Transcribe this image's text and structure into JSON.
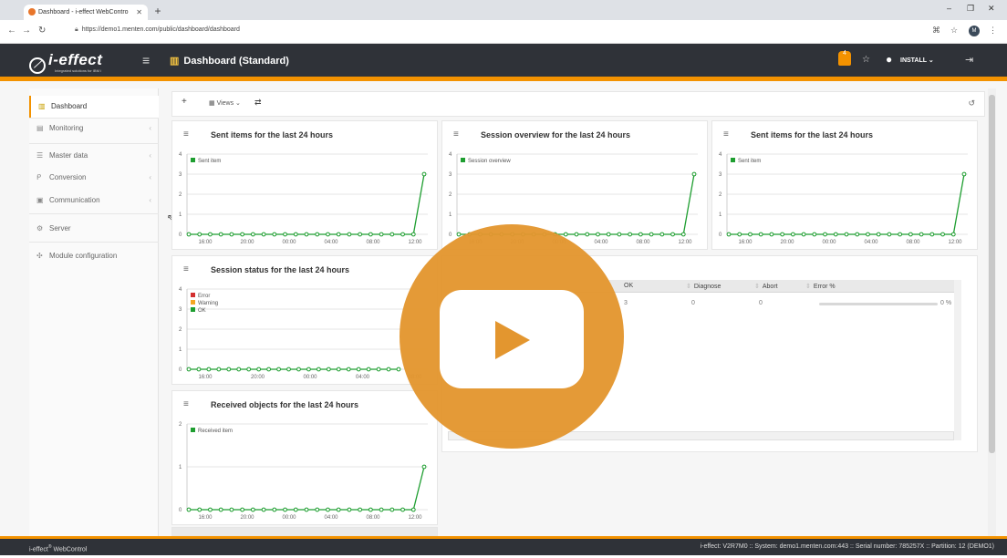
{
  "browser": {
    "tab_title": "Dashboard - i-effect WebContro",
    "url": "https://demo1.menten.com/public/dashboard/dashboard",
    "profile_initial": "M"
  },
  "header": {
    "logo": "i-effect",
    "logo_tagline": "Integrated solutions for IBM i",
    "title": "Dashboard (Standard)",
    "notification_count": "4",
    "user": "INSTALL"
  },
  "sidebar": {
    "items": [
      {
        "label": "Dashboard",
        "icon": "bar-chart-icon",
        "active": true
      },
      {
        "label": "Monitoring",
        "icon": "monitor-icon"
      },
      {
        "label": "Master data",
        "icon": "table-icon"
      },
      {
        "label": "Conversion",
        "icon": "conversion-icon"
      },
      {
        "label": "Communication",
        "icon": "communication-icon"
      },
      {
        "label": "Server",
        "icon": "cogs-icon"
      },
      {
        "label": "Module configuration",
        "icon": "modules-icon"
      }
    ]
  },
  "toolbar": {
    "views_label": "Views"
  },
  "widgets": {
    "sent_items_1": {
      "title": "Sent items for the last 24 hours"
    },
    "session_overview": {
      "title": "Session overview for the last 24 hours"
    },
    "sent_items_2": {
      "title": "Sent items for the last 24 hours"
    },
    "session_status": {
      "title": "Session status for the last 24 hours"
    },
    "received_objects": {
      "title": "Received objects for the last 24 hours"
    }
  },
  "table": {
    "columns": [
      "OK",
      "Diagnose",
      "Abort",
      "Error %"
    ],
    "row": {
      "ok": "3",
      "diagnose": "0",
      "abort": "0",
      "error_pct": "0 %"
    }
  },
  "footer": {
    "brand": "i-effect",
    "brand_suffix": "WebControl",
    "status": "i-effect: V2R7M0 :: System: demo1.menten.com:443 :: Serial number: 785257X :: Partition: 12 (DEMO1)"
  },
  "colors": {
    "accent": "#f39200",
    "header_bg": "#2f3238",
    "series_green": "#1e9e30",
    "series_red": "#d32f2f",
    "series_orange": "#f5a623",
    "play_overlay": "#e3962f"
  },
  "chart_data": [
    {
      "id": "sent_items_1",
      "type": "line",
      "title": "Sent items for the last 24 hours",
      "x": [
        "16:00",
        "20:00",
        "00:00",
        "04:00",
        "08:00",
        "12:00"
      ],
      "ylim": [
        0,
        4
      ],
      "yticks": [
        0,
        1,
        2,
        3,
        4
      ],
      "series": [
        {
          "name": "Sent item",
          "values": [
            0,
            0,
            0,
            0,
            0,
            0,
            0,
            0,
            0,
            0,
            0,
            0,
            0,
            0,
            0,
            0,
            0,
            0,
            0,
            0,
            0,
            0,
            3
          ]
        }
      ]
    },
    {
      "id": "session_overview",
      "type": "line",
      "title": "Session overview for the last 24 hours",
      "x": [
        "16:00",
        "20:00",
        "00:00",
        "04:00",
        "08:00",
        "12:00"
      ],
      "ylim": [
        0,
        4
      ],
      "yticks": [
        0,
        1,
        2,
        3,
        4
      ],
      "series": [
        {
          "name": "Session overview",
          "values": [
            0,
            0,
            0,
            0,
            0,
            0,
            0,
            0,
            0,
            0,
            0,
            0,
            0,
            0,
            0,
            0,
            0,
            0,
            0,
            0,
            0,
            0,
            3
          ]
        }
      ]
    },
    {
      "id": "sent_items_2",
      "type": "line",
      "title": "Sent items for the last 24 hours",
      "x": [
        "16:00",
        "20:00",
        "00:00",
        "04:00",
        "08:00",
        "12:00"
      ],
      "ylim": [
        0,
        4
      ],
      "yticks": [
        0,
        1,
        2,
        3,
        4
      ],
      "series": [
        {
          "name": "Sent item",
          "values": [
            0,
            0,
            0,
            0,
            0,
            0,
            0,
            0,
            0,
            0,
            0,
            0,
            0,
            0,
            0,
            0,
            0,
            0,
            0,
            0,
            0,
            0,
            3
          ]
        }
      ]
    },
    {
      "id": "session_status",
      "type": "line",
      "title": "Session status for the last 24 hours",
      "x": [
        "16:00",
        "20:00",
        "00:00",
        "04:00",
        "08:00"
      ],
      "ylim": [
        0,
        4
      ],
      "yticks": [
        0,
        1,
        2,
        3,
        4
      ],
      "series": [
        {
          "name": "Error",
          "values": []
        },
        {
          "name": "Warning",
          "values": []
        },
        {
          "name": "OK",
          "values": [
            0,
            0,
            0,
            0,
            0,
            0,
            0,
            0,
            0,
            0,
            0,
            0,
            0,
            0,
            0,
            0,
            0,
            0,
            0,
            0,
            0,
            0
          ]
        }
      ]
    },
    {
      "id": "received_objects",
      "type": "line",
      "title": "Received objects for the last 24 hours",
      "x": [
        "16:00",
        "20:00",
        "00:00",
        "04:00",
        "08:00",
        "12:00"
      ],
      "ylim": [
        0,
        2
      ],
      "yticks": [
        0,
        1,
        2
      ],
      "series": [
        {
          "name": "Received item",
          "values": [
            0,
            0,
            0,
            0,
            0,
            0,
            0,
            0,
            0,
            0,
            0,
            0,
            0,
            0,
            0,
            0,
            0,
            0,
            0,
            0,
            0,
            0,
            1
          ]
        }
      ]
    }
  ]
}
